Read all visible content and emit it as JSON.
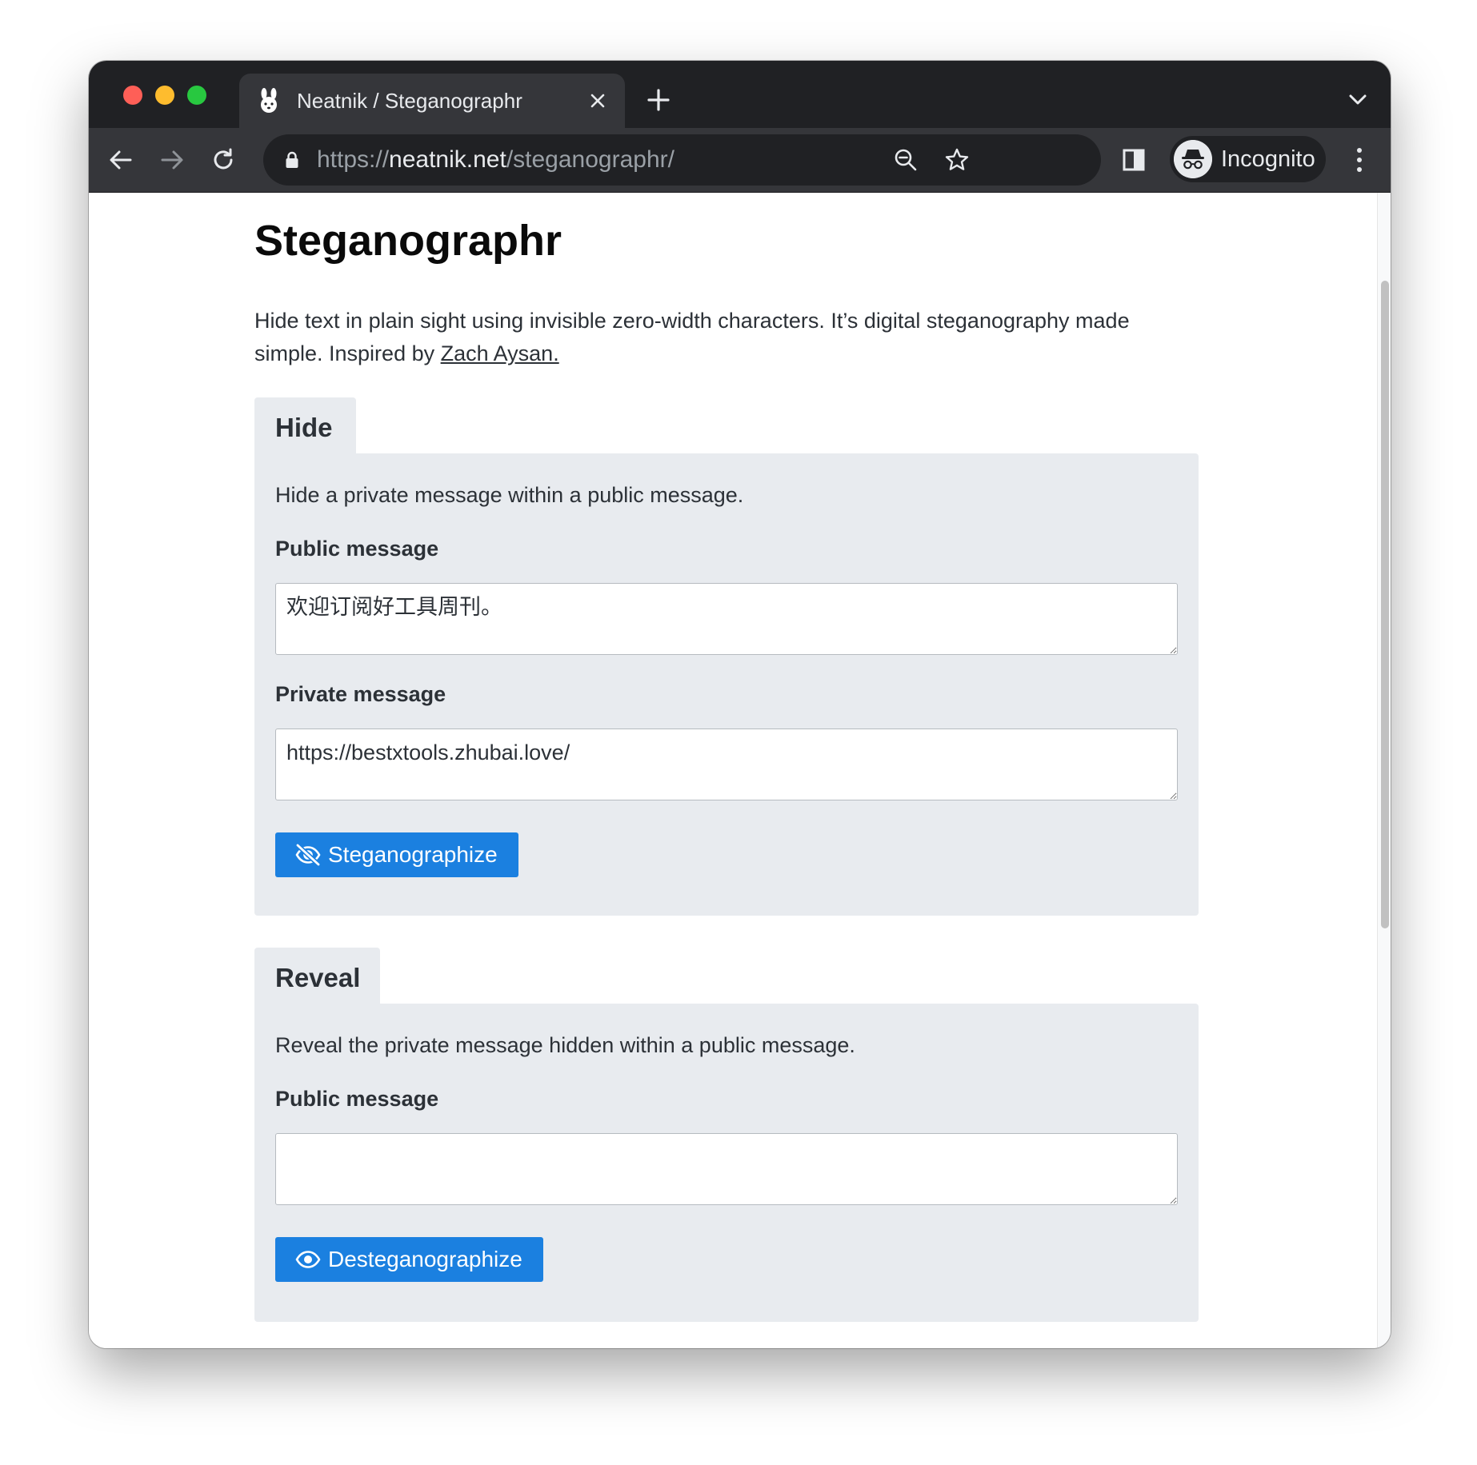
{
  "browser": {
    "tab": {
      "title": "Neatnik / Steganographr"
    },
    "address": {
      "scheme": "https://",
      "host": "neatnik.net",
      "path": "/steganographr/"
    },
    "profile": {
      "label": "Incognito"
    }
  },
  "page": {
    "title": "Steganographr",
    "intro": "Hide text in plain sight using invisible zero-width characters. It’s digital steganography made simple. Inspired by ",
    "intro_link": "Zach Aysan."
  },
  "hide": {
    "tab_label": "Hide",
    "description": "Hide a private message within a public message.",
    "public_label": "Public message",
    "public_value": "欢迎订阅好工具周刊。",
    "private_label": "Private message",
    "private_value": "https://bestxtools.zhubai.love/",
    "button_label": "Steganographize",
    "button_icon": "eye-slash-icon"
  },
  "reveal": {
    "tab_label": "Reveal",
    "description": "Reveal the private message hidden within a public message.",
    "public_label": "Public message",
    "public_value": "",
    "button_label": "Desteganographize",
    "button_icon": "eye-icon"
  },
  "colors": {
    "accent": "#1b80e0",
    "panel_bg": "#e8ebef",
    "chrome_dark": "#202124",
    "chrome_toolbar": "#35363a"
  }
}
